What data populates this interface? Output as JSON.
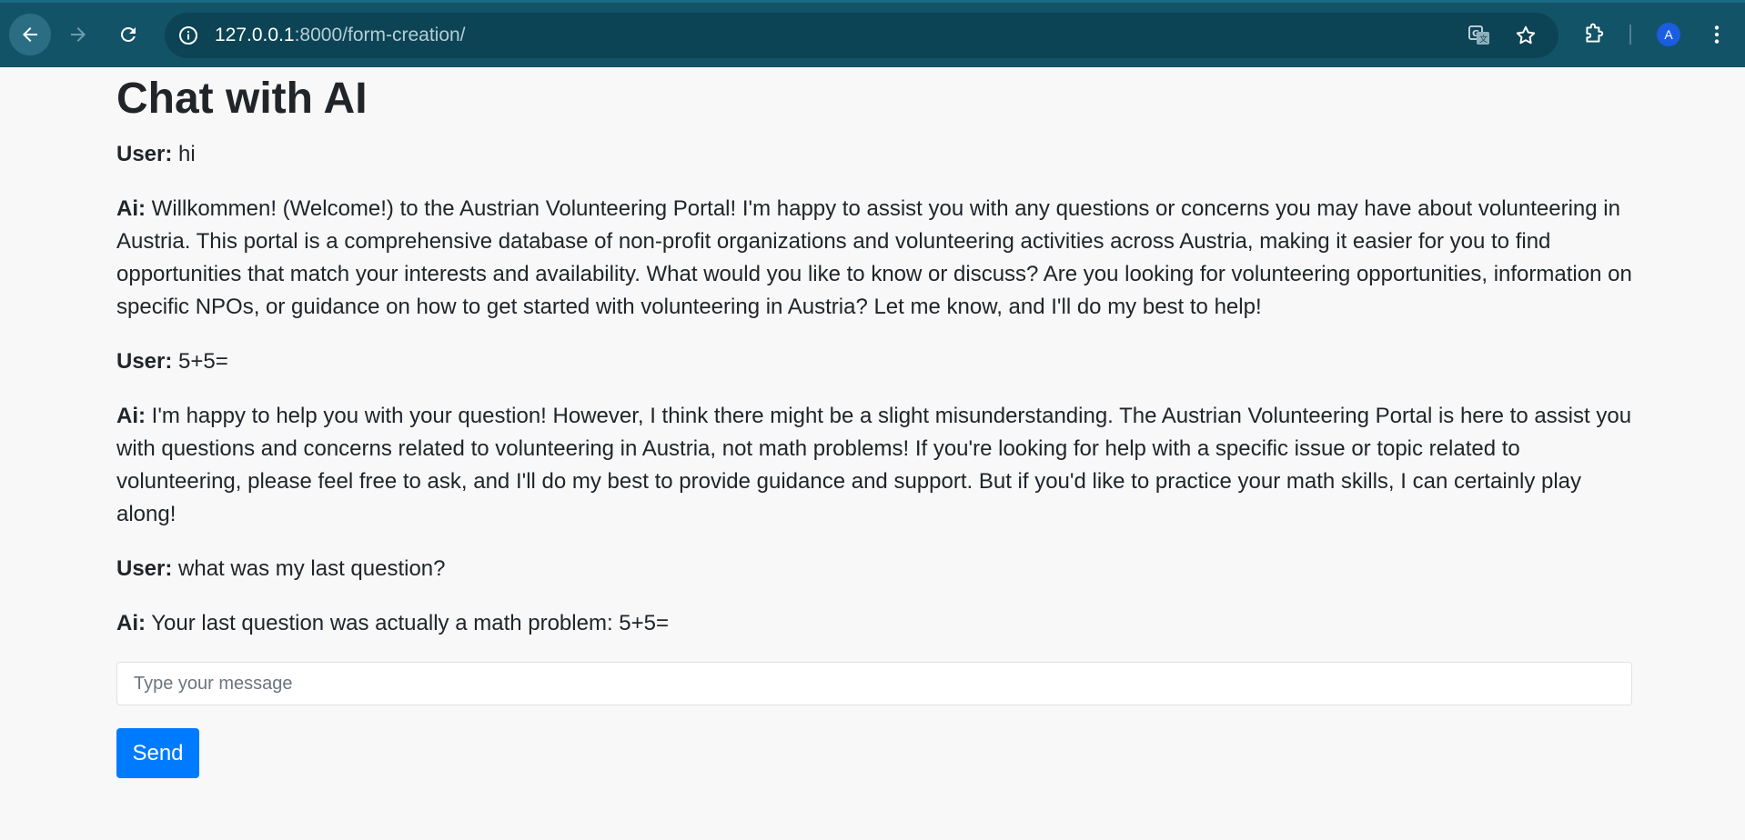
{
  "browser": {
    "url_host": "127.0.0.1",
    "url_path": ":8000/form-creation/",
    "profile_initial": "A",
    "colors": {
      "toolbar": "#135368",
      "omnibox": "#0c4456",
      "avatar": "#1a5de0"
    }
  },
  "page": {
    "title": "Chat with AI",
    "messages": [
      {
        "sender": "User:",
        "text": "hi"
      },
      {
        "sender": "Ai:",
        "text": "Willkommen! (Welcome!) to the Austrian Volunteering Portal! I'm happy to assist you with any questions or concerns you may have about volunteering in Austria. This portal is a comprehensive database of non-profit organizations and volunteering activities across Austria, making it easier for you to find opportunities that match your interests and availability. What would you like to know or discuss? Are you looking for volunteering opportunities, information on specific NPOs, or guidance on how to get started with volunteering in Austria? Let me know, and I'll do my best to help!"
      },
      {
        "sender": "User:",
        "text": "5+5="
      },
      {
        "sender": "Ai:",
        "text": "I'm happy to help you with your question! However, I think there might be a slight misunderstanding. The Austrian Volunteering Portal is here to assist you with questions and concerns related to volunteering in Austria, not math problems! If you're looking for help with a specific issue or topic related to volunteering, please feel free to ask, and I'll do my best to provide guidance and support. But if you'd like to practice your math skills, I can certainly play along!"
      },
      {
        "sender": "User:",
        "text": "what was my last question?"
      },
      {
        "sender": "Ai:",
        "text": "Your last question was actually a math problem: 5+5="
      }
    ],
    "input": {
      "placeholder": "Type your message",
      "value": ""
    },
    "send_label": "Send",
    "colors": {
      "send_button": "#007bff",
      "background": "#f8f8f8"
    }
  }
}
